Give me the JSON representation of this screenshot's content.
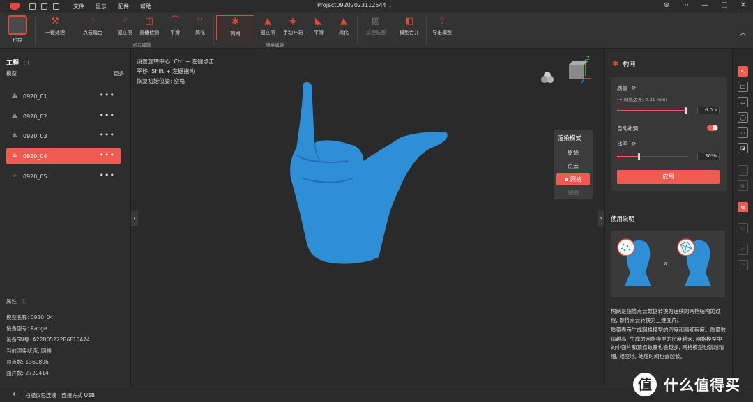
{
  "titlebar": {
    "menu": [
      "文件",
      "显示",
      "配件",
      "帮助"
    ],
    "project": "Project09202023112544"
  },
  "toolbar": {
    "scan": "扫描",
    "one_click": "一键处理",
    "pointcloud_group": {
      "label": "点云编辑",
      "items": [
        "点云融合",
        "孤立项",
        "重叠检测",
        "平滑",
        "简化"
      ]
    },
    "mesh_group": {
      "label": "网格编辑",
      "items": [
        "构网",
        "孤立项",
        "手动补洞",
        "平滑",
        "简化"
      ]
    },
    "texture": "纹理贴图",
    "merge": "模型合并",
    "export": "导出模型"
  },
  "left": {
    "title": "工程",
    "models_label": "模型",
    "more": "更多",
    "models": [
      {
        "name": "0920_01",
        "selected": false
      },
      {
        "name": "0920_02",
        "selected": false
      },
      {
        "name": "0920_03",
        "selected": false
      },
      {
        "name": "0920_04",
        "selected": true
      },
      {
        "name": "0920_05",
        "selected": false
      }
    ],
    "props_title": "属性",
    "props": [
      "模型名称: 0920_04",
      "设备型号: Range",
      "设备SN号: A22B05222B6F10A74",
      "当前渲染状态: 网格",
      "顶点数: 1360896",
      "面片数: 2720414"
    ]
  },
  "viewport": {
    "hints": [
      "设置旋转中心: Ctrl + 左键点击",
      "平移: Shift + 左键拖动",
      "恢复初始位姿: 空格"
    ],
    "render_mode": {
      "title": "渲染模式",
      "options": [
        "原始",
        "点云",
        "网格",
        "贴图"
      ],
      "selected": "网格"
    },
    "axis_label": "Z",
    "model_color": "#2f8fd6"
  },
  "right": {
    "title": "构网",
    "quality_label": "质量",
    "quality_hint": "(≈ 网格边长: 0.31 mm)",
    "quality_value": "6.0",
    "quality_level": 0.96,
    "auto_fill_label": "自动补洞",
    "auto_fill_on": true,
    "ratio_label": "比率",
    "ratio_value": "30%",
    "ratio_level": 0.3,
    "apply": "应用",
    "usage_title": "使用说明",
    "desc1": "构网是指将点云数据转换为连续的网格结构的过程, 即将点云转换为三维面片。",
    "desc2": "质量表示生成网格模型的密度和精细程度。质量数值越高, 生成的网格模型的密度越大, 网格模型中的小面片和顶点数量也会越多, 网格模型也就越精细, 相应地, 处理时间也会越长。"
  },
  "status": "扫描仪已连接 | 连接方式 USB",
  "watermark": "什么值得买",
  "accent": "#f05a50"
}
